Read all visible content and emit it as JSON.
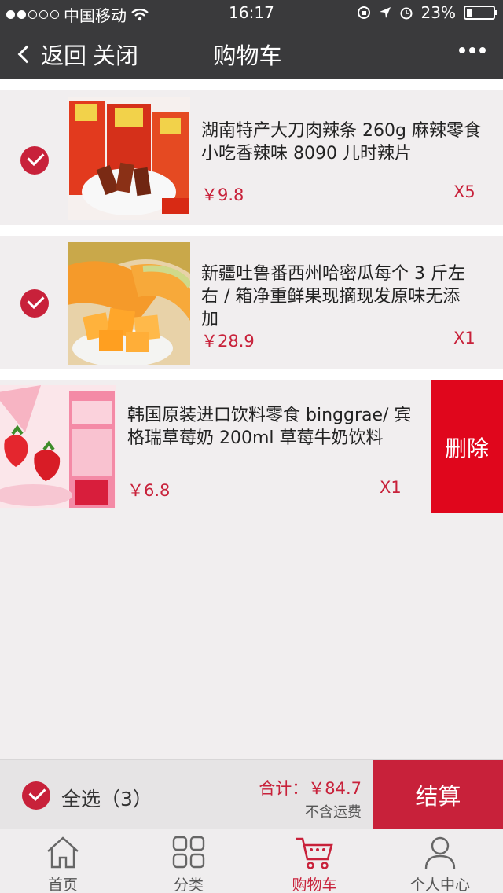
{
  "status_bar": {
    "carrier": "中国移动",
    "time": "16:17",
    "battery": "23%",
    "battery_level": 0.23
  },
  "nav": {
    "back_label": "返回",
    "close_label": "关闭",
    "title": "购物车"
  },
  "items": [
    {
      "name": "湖南特产大刀肉辣条 260g 麻辣零食小吃香辣味 8090 儿时辣片",
      "price": "￥9.8",
      "qty": "X5",
      "checked": true,
      "image": "spicy-snack-bags"
    },
    {
      "name": "新疆吐鲁番西州哈密瓜每个 3 斤左右 / 箱净重鲜果现摘现发原味无添加",
      "price": "￥28.9",
      "qty": "X1",
      "checked": true,
      "image": "hami-melon-slices"
    },
    {
      "name": "韩国原装进口饮料零食 binggrae/ 宾格瑞草莓奶 200ml 草莓牛奶饮料",
      "price": "￥6.8",
      "qty": "X1",
      "checked": false,
      "image": "strawberry-milk-carton",
      "delete_label": "删除"
    }
  ],
  "summary": {
    "select_all": "全选（3）",
    "total": "合计：￥84.7",
    "shipping_note": "不含运费",
    "checkout_label": "结算"
  },
  "tabbar": [
    {
      "label": "首页",
      "icon": "home-icon"
    },
    {
      "label": "分类",
      "icon": "grid-icon"
    },
    {
      "label": "购物车",
      "icon": "cart-icon"
    },
    {
      "label": "个人中心",
      "icon": "person-icon"
    }
  ],
  "colors": {
    "accent": "#c8213a",
    "delete": "#e0061c",
    "header": "#3a3a3c"
  }
}
